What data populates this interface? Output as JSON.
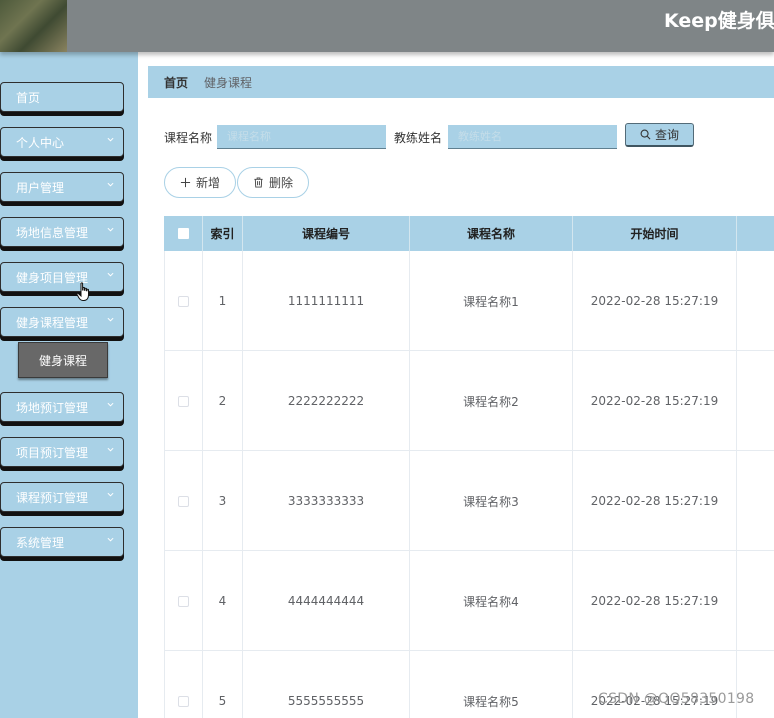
{
  "header": {
    "title": "Keep健身俱乐"
  },
  "sidebar": {
    "items": [
      {
        "label": "首页",
        "has_arrow": false
      },
      {
        "label": "个人中心",
        "has_arrow": true
      },
      {
        "label": "用户管理",
        "has_arrow": true
      },
      {
        "label": "场地信息管理",
        "has_arrow": true
      },
      {
        "label": "健身项目管理",
        "has_arrow": true
      },
      {
        "label": "健身课程管理",
        "has_arrow": true
      },
      {
        "label": "场地预订管理",
        "has_arrow": true
      },
      {
        "label": "项目预订管理",
        "has_arrow": true
      },
      {
        "label": "课程预订管理",
        "has_arrow": true
      },
      {
        "label": "系统管理",
        "has_arrow": true
      }
    ],
    "submenu": {
      "label": "健身课程"
    }
  },
  "breadcrumb": {
    "home": "首页",
    "current": "健身课程"
  },
  "search": {
    "course_name_label": "课程名称",
    "course_name_placeholder": "课程名称",
    "coach_name_label": "教练姓名",
    "coach_name_placeholder": "教练姓名",
    "query_label": "查询"
  },
  "actions": {
    "add_label": "新增",
    "delete_label": "删除"
  },
  "table": {
    "columns": [
      "索引",
      "课程编号",
      "课程名称",
      "开始时间"
    ],
    "rows": [
      {
        "index": "1",
        "code": "1111111111",
        "name": "课程名称1",
        "start": "2022-02-28 15:27:19"
      },
      {
        "index": "2",
        "code": "2222222222",
        "name": "课程名称2",
        "start": "2022-02-28 15:27:19"
      },
      {
        "index": "3",
        "code": "3333333333",
        "name": "课程名称3",
        "start": "2022-02-28 15:27:19"
      },
      {
        "index": "4",
        "code": "4444444444",
        "name": "课程名称4",
        "start": "2022-02-28 15:27:19"
      },
      {
        "index": "5",
        "code": "5555555555",
        "name": "课程名称5",
        "start": "2022-02-28 15:27:19"
      }
    ]
  },
  "watermark": "CSDN @QQ58350198",
  "colors": {
    "accent": "#a9d1e6",
    "header": "#7f8587",
    "submenu_active": "#686868"
  }
}
